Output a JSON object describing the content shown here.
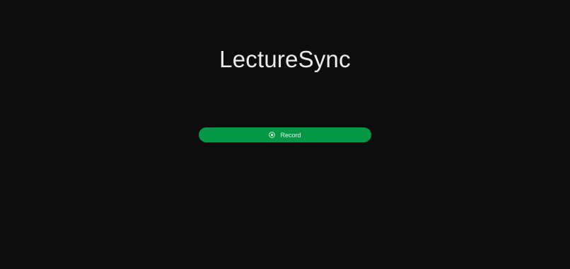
{
  "app": {
    "title": "LectureSync"
  },
  "record_button": {
    "label": "Record",
    "icon": "record-circle-icon"
  },
  "colors": {
    "background": "#0d0d0d",
    "title_text": "#ececec",
    "button_bg": "#049846",
    "button_text": "#e8f5ec"
  }
}
